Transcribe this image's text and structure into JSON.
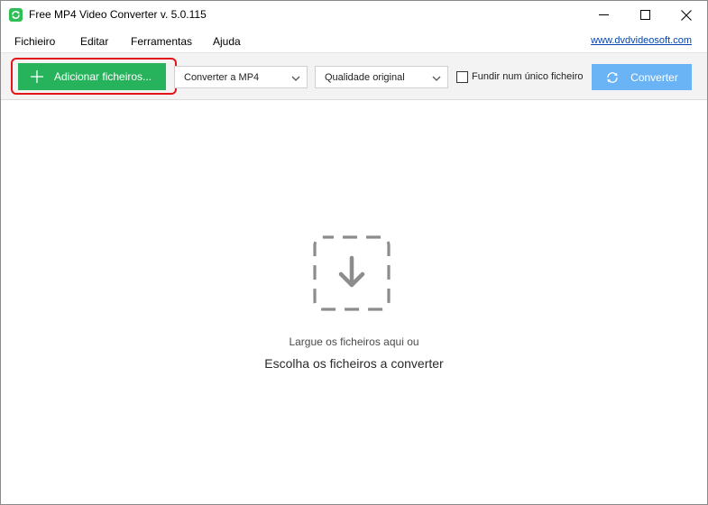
{
  "window": {
    "title": "Free MP4 Video Converter v. 5.0.115"
  },
  "menu": {
    "items": [
      "Fichieiro",
      "Editar",
      "Ferramentas",
      "Ajuda"
    ],
    "website_link": "www.dvdvideosoft.com"
  },
  "toolbar": {
    "add_files_label": "Adicionar ficheiros...",
    "format_selected": "Converter a MP4",
    "quality_selected": "Qualidade original",
    "merge_label": "Fundir num único ficheiro",
    "merge_checked": false,
    "convert_label": "Converter"
  },
  "dropzone": {
    "hint": "Largue os ficheiros aqui ou",
    "choose": "Escolha os ficheiros a converter"
  },
  "colors": {
    "add_button": "#27b35c",
    "convert_button": "#6ab4f5",
    "highlight": "#e3141a",
    "link": "#0645ad"
  }
}
